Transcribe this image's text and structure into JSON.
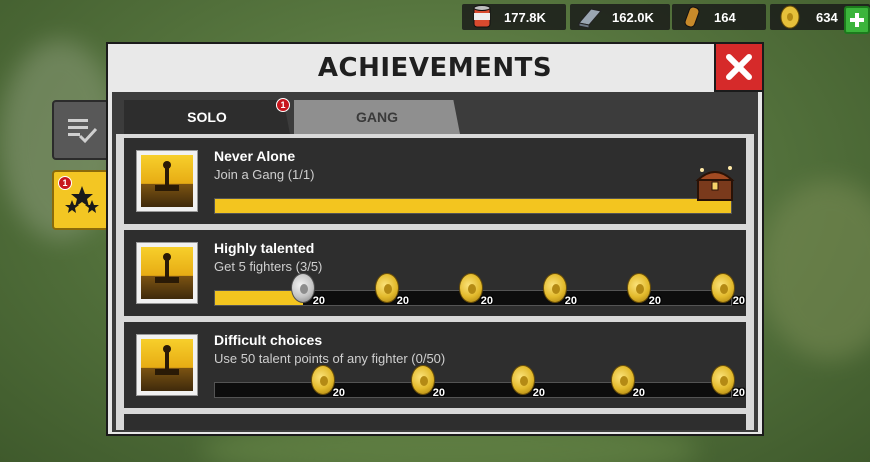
{
  "resources": {
    "items": [
      {
        "icon": "canned-food-icon",
        "value": "177.8K"
      },
      {
        "icon": "steel-bar-icon",
        "value": "162.0K"
      },
      {
        "icon": "gunpowder-icon",
        "value": "164"
      },
      {
        "icon": "gold-coin-icon",
        "value": "634"
      }
    ]
  },
  "side_tabs": {
    "list_icon": "checklist-icon",
    "achievements_icon": "stars-icon",
    "achievements_badge": "1"
  },
  "panel": {
    "title": "ACHIEVEMENTS",
    "close_icon": "close-icon",
    "tabs": [
      {
        "label": "SOLO",
        "badge": "1",
        "active": true
      },
      {
        "label": "GANG",
        "active": false
      }
    ]
  },
  "achievements": [
    {
      "title": "Never Alone",
      "description": "Join a Gang (1/1)",
      "progress": 1.0,
      "rewards": [],
      "reward_icon": "treasure-chest-icon"
    },
    {
      "title": "Highly talented",
      "description": "Get 5 fighters (3/5)",
      "progress": 0.17,
      "rewards": [
        {
          "amount": "20",
          "claimed": true
        },
        {
          "amount": "20",
          "claimed": false
        },
        {
          "amount": "20",
          "claimed": false
        },
        {
          "amount": "20",
          "claimed": false
        },
        {
          "amount": "20",
          "claimed": false
        },
        {
          "amount": "20",
          "claimed": false
        }
      ]
    },
    {
      "title": "Difficult choices",
      "description": "Use 50 talent points of any fighter (0/50)",
      "progress": 0.0,
      "rewards": [
        {
          "amount": "20",
          "claimed": false
        },
        {
          "amount": "20",
          "claimed": false
        },
        {
          "amount": "20",
          "claimed": false
        },
        {
          "amount": "20",
          "claimed": false
        },
        {
          "amount": "20",
          "claimed": false
        }
      ]
    }
  ],
  "colors": {
    "accent_yellow": "#f3c51f",
    "close_red": "#d62a2a",
    "plus_green": "#3bb43b"
  }
}
